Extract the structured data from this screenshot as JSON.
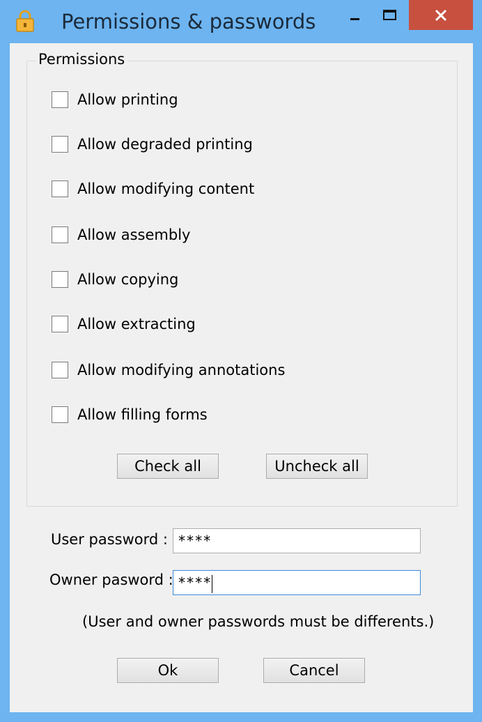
{
  "window": {
    "title": "Permissions & passwords",
    "icon": "lock-icon",
    "controls": {
      "minimize": "minimize-icon",
      "maximize": "maximize-icon",
      "close": "close-icon"
    },
    "colors": {
      "frame": "#6db4f0",
      "close_button": "#c7503f",
      "client": "#f0f0f0"
    }
  },
  "permissions": {
    "group_label": "Permissions",
    "items": [
      {
        "label": "Allow printing",
        "checked": false
      },
      {
        "label": "Allow degraded printing",
        "checked": false
      },
      {
        "label": "Allow modifying content",
        "checked": false
      },
      {
        "label": "Allow assembly",
        "checked": false
      },
      {
        "label": "Allow copying",
        "checked": false
      },
      {
        "label": "Allow extracting",
        "checked": false
      },
      {
        "label": "Allow modifying annotations",
        "checked": false
      },
      {
        "label": "Allow filling forms",
        "checked": false
      }
    ],
    "check_all_label": "Check all",
    "uncheck_all_label": "Uncheck all"
  },
  "passwords": {
    "user_label": "User password :",
    "user_value": "****",
    "owner_label": "Owner pasword :",
    "owner_value": "****",
    "note": "(User and owner passwords must be differents.)"
  },
  "footer": {
    "ok_label": "Ok",
    "cancel_label": "Cancel"
  }
}
